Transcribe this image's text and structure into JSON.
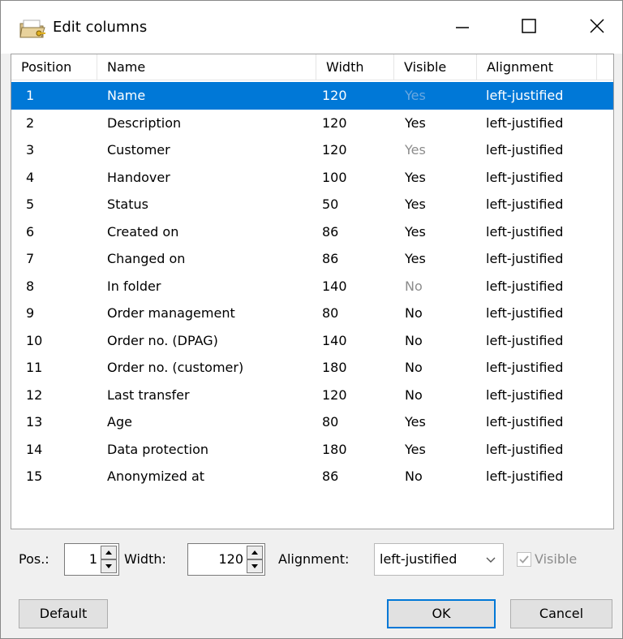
{
  "window": {
    "title": "Edit columns",
    "icon": "folder-key-icon",
    "controls": [
      "minimize-icon",
      "maximize-icon",
      "close-icon"
    ]
  },
  "columns": {
    "headers": [
      "Position",
      "Name",
      "Width",
      "Visible",
      "Alignment"
    ],
    "rows": [
      {
        "pos": "1",
        "name": "Name",
        "width": "120",
        "visible": "Yes",
        "visible_dim": true,
        "alignment": "left-justified",
        "selected": true
      },
      {
        "pos": "2",
        "name": "Description",
        "width": "120",
        "visible": "Yes",
        "visible_dim": false,
        "alignment": "left-justified"
      },
      {
        "pos": "3",
        "name": "Customer",
        "width": "120",
        "visible": "Yes",
        "visible_dim": true,
        "alignment": "left-justified"
      },
      {
        "pos": "4",
        "name": "Handover",
        "width": "100",
        "visible": "Yes",
        "visible_dim": false,
        "alignment": "left-justified"
      },
      {
        "pos": "5",
        "name": "Status",
        "width": "50",
        "visible": "Yes",
        "visible_dim": false,
        "alignment": "left-justified"
      },
      {
        "pos": "6",
        "name": "Created on",
        "width": "86",
        "visible": "Yes",
        "visible_dim": false,
        "alignment": "left-justified"
      },
      {
        "pos": "7",
        "name": "Changed on",
        "width": "86",
        "visible": "Yes",
        "visible_dim": false,
        "alignment": "left-justified"
      },
      {
        "pos": "8",
        "name": "In folder",
        "width": "140",
        "visible": "No",
        "visible_dim": true,
        "alignment": "left-justified"
      },
      {
        "pos": "9",
        "name": "Order management",
        "width": "80",
        "visible": "No",
        "visible_dim": false,
        "alignment": "left-justified"
      },
      {
        "pos": "10",
        "name": "Order no. (DPAG)",
        "width": "140",
        "visible": "No",
        "visible_dim": false,
        "alignment": "left-justified"
      },
      {
        "pos": "11",
        "name": "Order no. (customer)",
        "width": "180",
        "visible": "No",
        "visible_dim": false,
        "alignment": "left-justified"
      },
      {
        "pos": "12",
        "name": "Last transfer",
        "width": "120",
        "visible": "No",
        "visible_dim": false,
        "alignment": "left-justified"
      },
      {
        "pos": "13",
        "name": "Age",
        "width": "80",
        "visible": "Yes",
        "visible_dim": false,
        "alignment": "left-justified"
      },
      {
        "pos": "14",
        "name": "Data protection",
        "width": "180",
        "visible": "Yes",
        "visible_dim": false,
        "alignment": "left-justified"
      },
      {
        "pos": "15",
        "name": "Anonymized at",
        "width": "86",
        "visible": "No",
        "visible_dim": false,
        "alignment": "left-justified"
      }
    ]
  },
  "editor": {
    "pos_label": "Pos.:",
    "pos_value": "1",
    "width_label": "Width:",
    "width_value": "120",
    "alignment_label": "Alignment:",
    "alignment_value": "left-justified",
    "visible_label": "Visible",
    "visible_checked": true,
    "visible_disabled": true
  },
  "buttons": {
    "default_label": "Default",
    "ok_label": "OK",
    "cancel_label": "Cancel"
  },
  "colors": {
    "selection": "#0078d7",
    "dim_text": "#8c8c8c",
    "dialog_bg": "#f0f0f0"
  }
}
